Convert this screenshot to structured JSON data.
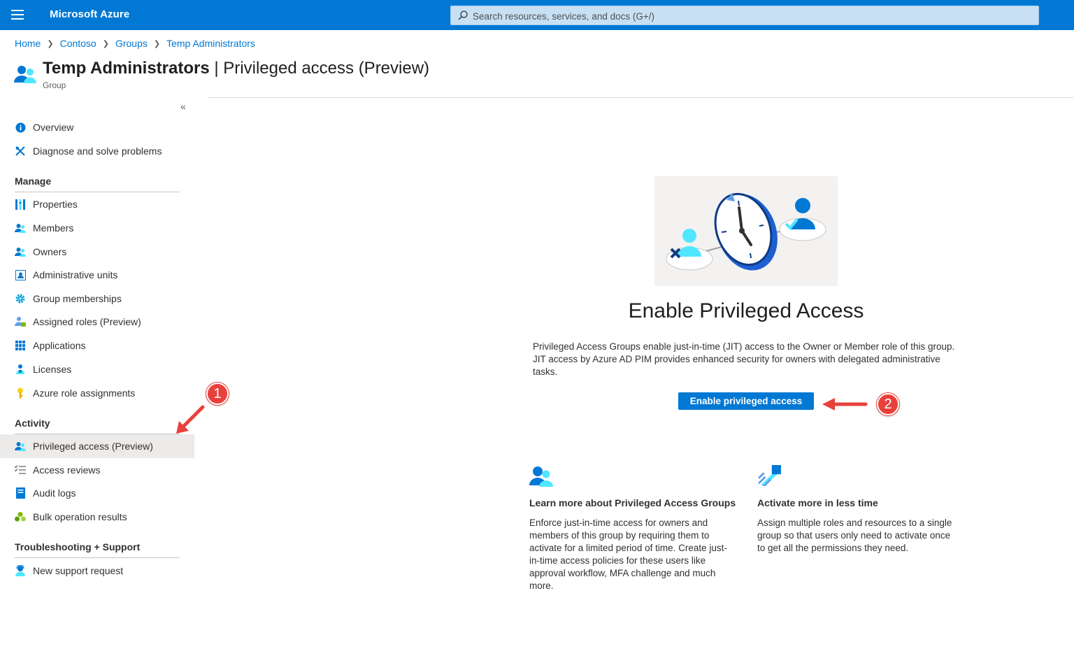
{
  "topbar": {
    "brand": "Microsoft Azure",
    "search_placeholder": "Search resources, services, and docs (G+/)",
    "color": "#0078d4"
  },
  "breadcrumb": [
    "Home",
    "Contoso",
    "Groups",
    "Temp Administrators"
  ],
  "header": {
    "title_bold": "Temp Administrators",
    "title_rest": " | Privileged access (Preview)",
    "subtitle": "Group"
  },
  "sidebar": {
    "collapse_glyph": "«",
    "top_items": [
      {
        "label": "Overview",
        "icon": "info-icon"
      },
      {
        "label": "Diagnose and solve problems",
        "icon": "wrench-icon"
      }
    ],
    "sections": [
      {
        "heading": "Manage",
        "items": [
          {
            "label": "Properties",
            "icon": "properties-icon"
          },
          {
            "label": "Members",
            "icon": "members-icon"
          },
          {
            "label": "Owners",
            "icon": "owners-icon"
          },
          {
            "label": "Administrative units",
            "icon": "admin-units-icon"
          },
          {
            "label": "Group memberships",
            "icon": "gear-icon"
          },
          {
            "label": "Assigned roles (Preview)",
            "icon": "assigned-roles-icon"
          },
          {
            "label": "Applications",
            "icon": "apps-grid-icon"
          },
          {
            "label": "Licenses",
            "icon": "license-icon"
          },
          {
            "label": "Azure role assignments",
            "icon": "key-icon"
          }
        ]
      },
      {
        "heading": "Activity",
        "items": [
          {
            "label": "Privileged access (Preview)",
            "icon": "privileged-access-icon",
            "selected": true
          },
          {
            "label": "Access reviews",
            "icon": "checklist-icon"
          },
          {
            "label": "Audit logs",
            "icon": "log-icon"
          },
          {
            "label": "Bulk operation results",
            "icon": "bulk-icon"
          }
        ]
      },
      {
        "heading": "Troubleshooting + Support",
        "items": [
          {
            "label": "New support request",
            "icon": "support-icon"
          }
        ]
      }
    ]
  },
  "main": {
    "heading": "Enable Privileged Access",
    "description": "Privileged Access Groups enable just-in-time (JIT) access to the Owner or Member role of this group. JIT access by Azure AD PIM provides enhanced security for owners with delegated administrative tasks.",
    "enable_button": "Enable privileged access",
    "cards": [
      {
        "icon": "group-icon",
        "title": "Learn more about Privileged Access Groups",
        "text": "Enforce just-in-time access for owners and members of this group by requiring them to activate for a limited period of time. Create just-in-time access policies for these users like approval workflow, MFA challenge and much more."
      },
      {
        "icon": "rocket-icon",
        "title": "Activate more in less time",
        "text": "Assign multiple roles and resources to a single group so that users only need to activate once to get all the permissions they need."
      }
    ]
  },
  "callouts": [
    "1",
    "2"
  ],
  "colors": {
    "accent": "#0078d4",
    "callout": "#e8413c",
    "selected_bg": "#edebe9"
  }
}
